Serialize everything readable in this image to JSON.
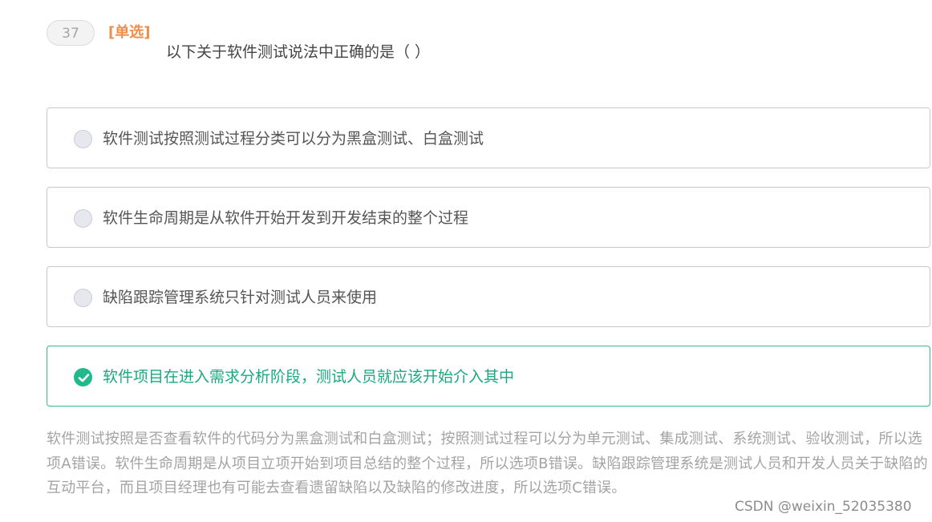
{
  "question": {
    "number": "37",
    "type": "[单选]",
    "stem": "以下关于软件测试说法中正确的是（ ）"
  },
  "options": [
    {
      "label": "软件测试按照测试过程分类可以分为黑盒测试、白盒测试",
      "selected": false
    },
    {
      "label": "软件生命周期是从软件开始开发到开发结束的整个过程",
      "selected": false
    },
    {
      "label": "缺陷跟踪管理系统只针对测试人员来使用",
      "selected": false
    },
    {
      "label": "软件项目在进入需求分析阶段，测试人员就应该开始介入其中",
      "selected": true
    }
  ],
  "analysis": "软件测试按照是否查看软件的代码分为黑盒测试和白盒测试；按照测试过程可以分为单元测试、集成测试、系统测试、验收测试，所以选项A错误。软件生命周期是从项目立项开始到项目总结的整个过程，所以选项B错误。缺陷跟踪管理系统是测试人员和开发人员关于缺陷的互动平台，而且项目经理也有可能去查看遗留缺陷以及缺陷的修改进度，所以选项C错误。",
  "watermark": "CSDN @weixin_52035380",
  "colors": {
    "type_label": "#ef8d4a",
    "selected_accent": "#21b98c",
    "option_border": "#c9c9c9",
    "analysis_text": "#a3a3a3"
  },
  "icons": {
    "unselected": "radio-empty-icon",
    "selected": "check-circle-icon"
  }
}
